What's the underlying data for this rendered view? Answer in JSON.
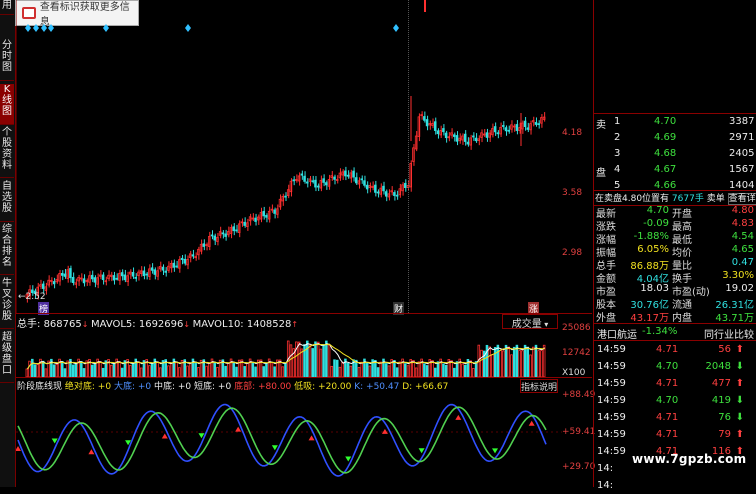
{
  "tooltip": {
    "text": "查看标识获取更多信息"
  },
  "left_tabs": [
    "用",
    "分时图",
    "K线图",
    "个股资料",
    "自选股",
    "综合排名",
    "牛叉诊股",
    "超级盘口"
  ],
  "price_axis": {
    "labels": [
      "4.18",
      "3.58",
      "2.98"
    ],
    "low_label": "←2.52"
  },
  "markers": {
    "m1": "榜",
    "m2": "财",
    "m3": "涨"
  },
  "volume": {
    "header": {
      "prefix": "总手: ",
      "total": "868765",
      "mavol5": "MAVOL5: 1692696",
      "mavol10": "MAVOL10: 1408528"
    },
    "tab": "成交量",
    "axis": {
      "top": "25086",
      "mid": "12742",
      "unit": "X100"
    }
  },
  "indicator": {
    "header": {
      "name": "阶段底线现",
      "a": "绝对底: +0",
      "b": "大底: +0",
      "c": "中底: +0",
      "d": "短底: +0",
      "e": "底部: +80.00",
      "f": "低吸: +20.00",
      "g": "K: +50.47",
      "h": "D: +66.67"
    },
    "tab": "指标说明",
    "axis": {
      "top": "+88.49",
      "mid": "+59.41",
      "bottom": "+29.70"
    }
  },
  "order_book": [
    {
      "side": "卖",
      "level": "1",
      "price": "4.70",
      "vol": "3387"
    },
    {
      "side": "",
      "level": "2",
      "price": "4.69",
      "vol": "2971"
    },
    {
      "side": "",
      "level": "3",
      "price": "4.68",
      "vol": "2405"
    },
    {
      "side": "盘",
      "level": "4",
      "price": "4.67",
      "vol": "1567"
    },
    {
      "side": "",
      "level": "5",
      "price": "4.66",
      "vol": "1404"
    }
  ],
  "pending": {
    "text": "在卖盘4.80位置有",
    "vol": "7677手",
    "label": "卖单",
    "link": "查看详细"
  },
  "stats": [
    {
      "l1": "最新",
      "v1": "4.70",
      "c1": "green",
      "l2": "开盘",
      "v2": "4.80",
      "c2": "red"
    },
    {
      "l1": "涨跌",
      "v1": "-0.09",
      "c1": "green",
      "l2": "最高",
      "v2": "4.83",
      "c2": "red"
    },
    {
      "l1": "涨幅",
      "v1": "-1.88%",
      "c1": "green",
      "l2": "最低",
      "v2": "4.54",
      "c2": "green"
    },
    {
      "l1": "振幅",
      "v1": "6.05%",
      "c1": "yellow",
      "l2": "均价",
      "v2": "4.65",
      "c2": "green"
    },
    {
      "l1": "总手",
      "v1": "86.88万",
      "c1": "yellow",
      "l2": "量比",
      "v2": "0.47",
      "c2": "cyan"
    },
    {
      "l1": "金额",
      "v1": "4.04亿",
      "c1": "cyan",
      "l2": "换手",
      "v2": "3.30%",
      "c2": "yellow"
    },
    {
      "l1": "市盈",
      "v1": "18.03",
      "c1": "white",
      "l2": "市盈(动)",
      "v2": "19.02",
      "c2": "white"
    },
    {
      "l1": "股本",
      "v1": "30.76亿",
      "c1": "cyan",
      "l2": "流通",
      "v2": "26.31亿",
      "c2": "cyan"
    },
    {
      "l1": "外盘",
      "v1": "43.17万",
      "c1": "red",
      "l2": "内盘",
      "v2": "43.71万",
      "c2": "green"
    }
  ],
  "sector": {
    "name": "港口航运",
    "pct": "-1.34%",
    "link": "同行业比较"
  },
  "ticks": [
    {
      "time": "14:59",
      "price": "4.71",
      "vol": "56",
      "dir": "up"
    },
    {
      "time": "14:59",
      "price": "4.70",
      "vol": "2048",
      "dir": "down"
    },
    {
      "time": "14:59",
      "price": "4.71",
      "vol": "477",
      "dir": "up"
    },
    {
      "time": "14:59",
      "price": "4.70",
      "vol": "419",
      "dir": "down"
    },
    {
      "time": "14:59",
      "price": "4.71",
      "vol": "76",
      "dir": "down"
    },
    {
      "time": "14:59",
      "price": "4.71",
      "vol": "79",
      "dir": "up"
    },
    {
      "time": "14:59",
      "price": "4.71",
      "vol": "116",
      "dir": "up"
    },
    {
      "time": "14:",
      "price": "",
      "vol": "",
      "dir": ""
    },
    {
      "time": "14:",
      "price": "",
      "vol": "",
      "dir": ""
    }
  ],
  "watermark": "www.7gpzb.com",
  "colors": {
    "up": "#ff3030",
    "down": "#30ff30",
    "grid": "#8a0000",
    "indicator_line1": "#3050ff",
    "indicator_line2": "#50d050"
  }
}
